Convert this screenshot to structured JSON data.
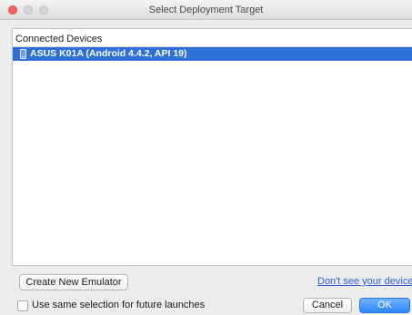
{
  "window": {
    "title": "Select Deployment Target"
  },
  "devices": {
    "section_label": "Connected Devices",
    "items": [
      {
        "label": "ASUS K01A (Android 4.4.2, API 19)",
        "selected": true,
        "icon": "phone-icon"
      }
    ]
  },
  "actions": {
    "create_emulator_label": "Create New Emulator",
    "help_link_label": "Don't see your device?",
    "remember_label": "Use same selection for future launches",
    "remember_checked": false,
    "cancel_label": "Cancel",
    "ok_label": "OK"
  },
  "colors": {
    "selection": "#2f6fd8",
    "primary_button": "#2c86f8",
    "link": "#2a5fd1"
  }
}
